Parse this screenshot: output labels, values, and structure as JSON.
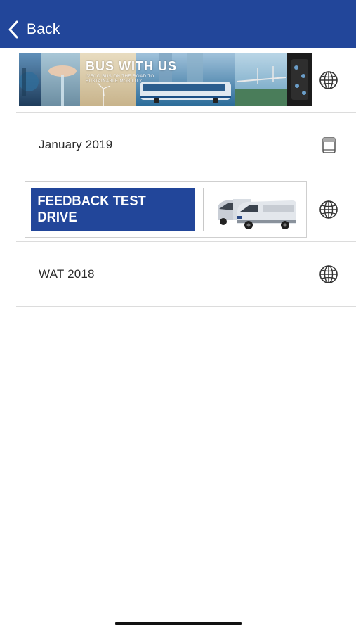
{
  "header": {
    "back_label": "Back",
    "bg_color": "#22469a"
  },
  "banner_bus": {
    "title": "BUS WITH US",
    "subtitle": "IVECO BUS ON THE ROAD TO SUSTAINABLE MOBILITY"
  },
  "list": {
    "items": [
      {
        "type": "banner",
        "banner": "bus-with-us",
        "icon": "globe-icon"
      },
      {
        "type": "text",
        "label": "January 2019",
        "icon": "book-icon"
      },
      {
        "type": "banner",
        "banner": "feedback-test-drive",
        "label": "FEEDBACK TEST DRIVE",
        "icon": "globe-icon"
      },
      {
        "type": "text",
        "label": "WAT 2018",
        "icon": "globe-icon"
      }
    ]
  }
}
